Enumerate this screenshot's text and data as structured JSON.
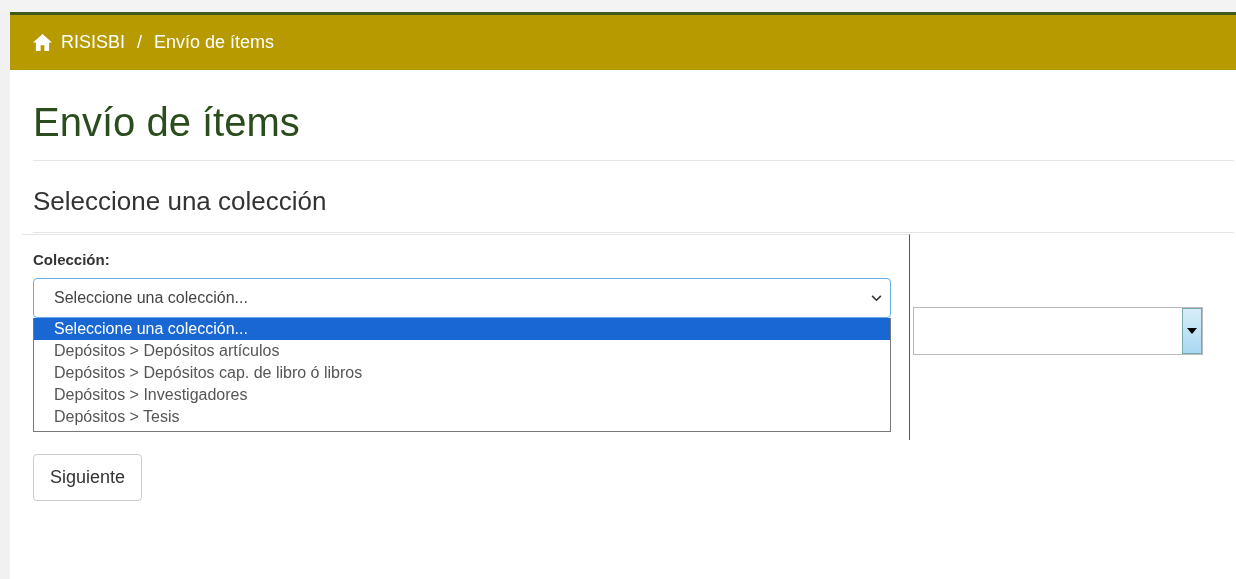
{
  "breadcrumb": [
    {
      "label": "RISISBI",
      "kind": "home"
    },
    {
      "label": "Envío de ítems",
      "kind": "current"
    }
  ],
  "breadcrumb_separator": "/",
  "page_title": "Envío de ítems",
  "section_title": "Seleccione una colección",
  "collection_field": {
    "label": "Colección:",
    "value": "Seleccione una colección...",
    "expanded": true,
    "options": [
      {
        "label": "Seleccione una colección...",
        "selected": true
      },
      {
        "label": "Depósitos > Depósitos artículos",
        "selected": false
      },
      {
        "label": "Depósitos > Depósitos cap. de libro ó libros",
        "selected": false
      },
      {
        "label": "Depósitos > Investigadores",
        "selected": false
      },
      {
        "label": "Depósitos > Tesis",
        "selected": false
      }
    ]
  },
  "next_button": "Siguiente"
}
